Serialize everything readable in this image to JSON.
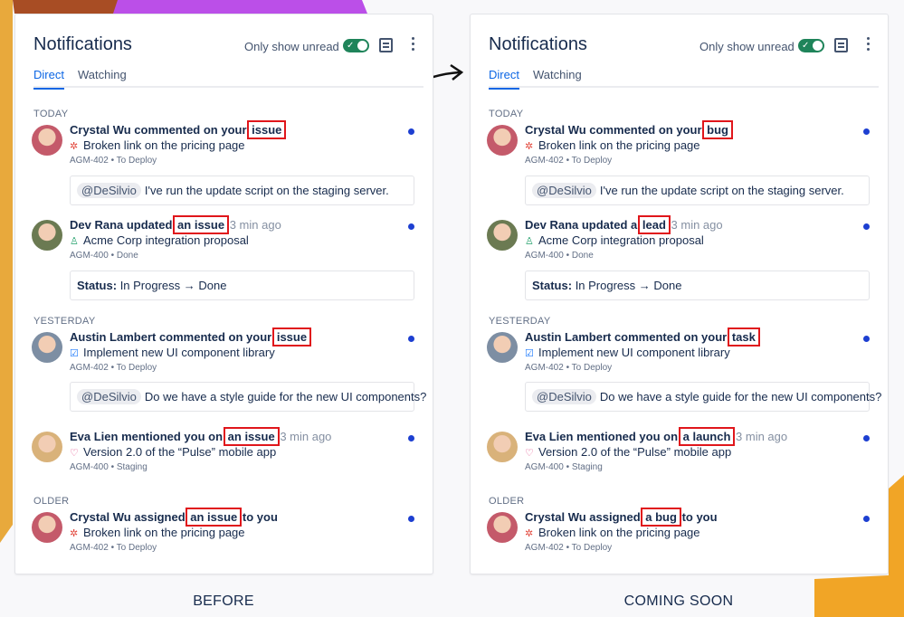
{
  "colors": {
    "accent": "#0c66e4",
    "unread_dot": "#1d3fd1",
    "highlight": "#e0161b",
    "toggle_on": "#1f845a"
  },
  "panels": [
    {
      "caption": "BEFORE",
      "title": "Notifications",
      "unread_label": "Only show unread",
      "unread_on": true,
      "tabs": [
        "Direct",
        "Watching"
      ],
      "active_tab": "Direct",
      "sections": [
        {
          "label": "TODAY",
          "items": [
            {
              "pre": "Crystal Wu commented on your",
              "obj": "issue",
              "post": "",
              "post_style": "",
              "icon": "bug-icon",
              "subtitle": "Broken link on the pricing page",
              "meta": "AGM-402 • To Deploy",
              "box": {
                "mention": "@DeSilvio",
                "text": "I've run the update script on the staging server."
              },
              "avatar": "#c45a6a",
              "unread": true
            },
            {
              "pre": "Dev Rana updated",
              "obj": "an issue",
              "post": "3 min ago",
              "post_style": "time",
              "icon": "person-icon",
              "subtitle": "Acme Corp integration proposal",
              "meta": "AGM-400 • Done",
              "box": {
                "bold": "Status:",
                "text": "In Progress → Done"
              },
              "avatar": "#6b7a52",
              "unread": true
            }
          ]
        },
        {
          "label": "YESTERDAY",
          "items": [
            {
              "pre": "Austin Lambert commented on your",
              "obj": "issue",
              "post": "",
              "post_style": "",
              "icon": "checkbox-icon",
              "subtitle": "Implement new UI component library",
              "meta": "AGM-402 • To Deploy",
              "box": {
                "mention": "@DeSilvio",
                "text": "Do we have a style guide for the new UI components?"
              },
              "avatar": "#7d8ea3",
              "unread": true
            },
            {
              "pre": "Eva Lien mentioned you on",
              "obj": "an issue",
              "post": "3 min ago",
              "post_style": "time",
              "icon": "heart-icon",
              "subtitle": "Version 2.0 of the “Pulse” mobile app",
              "meta": "AGM-400 • Staging",
              "avatar": "#d9b27a",
              "unread": true
            }
          ]
        },
        {
          "label": "OLDER",
          "items": [
            {
              "pre": "Crystal Wu assigned",
              "obj": "an issue",
              "post": "to you",
              "post_style": "",
              "icon": "bug-icon",
              "subtitle": "Broken link on the pricing page",
              "meta": "AGM-402 • To Deploy",
              "avatar": "#c45a6a",
              "unread": true
            }
          ]
        }
      ]
    },
    {
      "caption": "COMING SOON",
      "title": "Notifications",
      "unread_label": "Only show unread",
      "unread_on": true,
      "tabs": [
        "Direct",
        "Watching"
      ],
      "active_tab": "Direct",
      "sections": [
        {
          "label": "TODAY",
          "items": [
            {
              "pre": "Crystal Wu commented on your",
              "obj": "bug",
              "post": "",
              "post_style": "",
              "icon": "bug-icon",
              "subtitle": "Broken link on the pricing page",
              "meta": "AGM-402 • To Deploy",
              "box": {
                "mention": "@DeSilvio",
                "text": "I've run the update script on the staging server."
              },
              "avatar": "#c45a6a",
              "unread": true
            },
            {
              "pre": "Dev Rana updated a",
              "obj": "lead",
              "post": "3 min ago",
              "post_style": "time",
              "icon": "person-icon",
              "subtitle": "Acme Corp integration proposal",
              "meta": "AGM-400 • Done",
              "box": {
                "bold": "Status:",
                "text": "In Progress → Done"
              },
              "avatar": "#6b7a52",
              "unread": true
            }
          ]
        },
        {
          "label": "YESTERDAY",
          "items": [
            {
              "pre": "Austin Lambert commented on your",
              "obj": "task",
              "post": "",
              "post_style": "",
              "icon": "checkbox-icon",
              "subtitle": "Implement new UI component library",
              "meta": "AGM-402 • To Deploy",
              "box": {
                "mention": "@DeSilvio",
                "text": "Do we have a style guide for the new UI components?"
              },
              "avatar": "#7d8ea3",
              "unread": true
            },
            {
              "pre": "Eva Lien mentioned you on",
              "obj": "a launch",
              "post": "3 min ago",
              "post_style": "time",
              "icon": "heart-icon",
              "subtitle": "Version 2.0 of the “Pulse” mobile app",
              "meta": "AGM-400 • Staging",
              "avatar": "#d9b27a",
              "unread": true
            }
          ]
        },
        {
          "label": "OLDER",
          "items": [
            {
              "pre": "Crystal Wu assigned",
              "obj": "a bug",
              "post": "to you",
              "post_style": "",
              "icon": "bug-icon",
              "subtitle": "Broken link on the pricing page",
              "meta": "AGM-402 • To Deploy",
              "avatar": "#c45a6a",
              "unread": true
            }
          ]
        }
      ]
    }
  ]
}
